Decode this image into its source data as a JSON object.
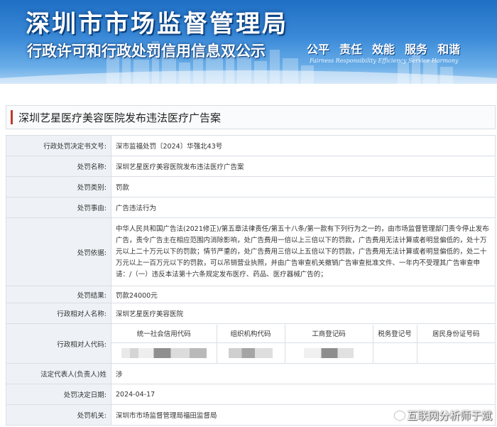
{
  "header": {
    "title": "深圳市市场监督管理局",
    "subtitle": "行政许可和行政处罚信用信息双公示",
    "slogans": [
      "公平",
      "责任",
      "效能",
      "服务",
      "和谐"
    ],
    "slogans_en": "Fairness  Responsibility  Efficiency  Service  Harmony"
  },
  "case_title": "深圳艺星医疗美容医院发布违法医疗广告案",
  "fields": {
    "decision_no_label": "行政处罚决定书文号:",
    "decision_no": "深市监福处罚〔2024〕华强北43号",
    "case_name_label": "处罚名称:",
    "case_name": "深圳艺星医疗美容医院发布违法医疗广告案",
    "category_label": "处罚类别:",
    "category": "罚款",
    "reason_label": "处罚事由:",
    "reason": "广告违法行为",
    "basis_label": "处罚依据:",
    "basis": "中华人民共和国广告法(2021修正)/第五章法律责任/第五十八条/第一款有下列行为之一的，由市场监督管理部门责令停止发布广告，责令广告主在相应范围内消除影响，处广告费用一倍以上三倍以下的罚款，广告费用无法计算或者明显偏低的，处十万元以上二十万元以下的罚款；情节严重的，处广告费用三倍以上五倍以下的罚款，广告费用无法计算或者明显偏低的，处二十万元以上一百万元以下的罚款，可以吊销营业执照，并由广告审查机关撤销广告审查批准文件、一年内不受理其广告审查申请：/（一）违反本法第十六条规定发布医疗、药品、医疗器械广告的；",
    "result_label": "处罚结果:",
    "result": "罚款24000元",
    "party_label": "行政相对人名称:",
    "party": "深圳艺星医疗美容医院",
    "party_code_label": "行政相对人代码:",
    "code_headers": [
      "统一社会信用代码",
      "组织机构代码",
      "工商登记码",
      "税务登记号",
      "居民身份证号码"
    ],
    "legal_rep_label": "法定代表人(负责人)姓",
    "legal_rep": "涉",
    "decision_date_label": "处罚决定日期:",
    "decision_date": "2024-04-17",
    "authority_label": "处罚机关:",
    "authority": "深圳市市场监督管理局福田监督局"
  },
  "watermark": "互联网分析师于斌",
  "colors": {
    "banner_blue": "#1f6fc4",
    "label_bg": "#eef2f6",
    "accent_red": "#c0392b",
    "border": "#d9dee4"
  }
}
